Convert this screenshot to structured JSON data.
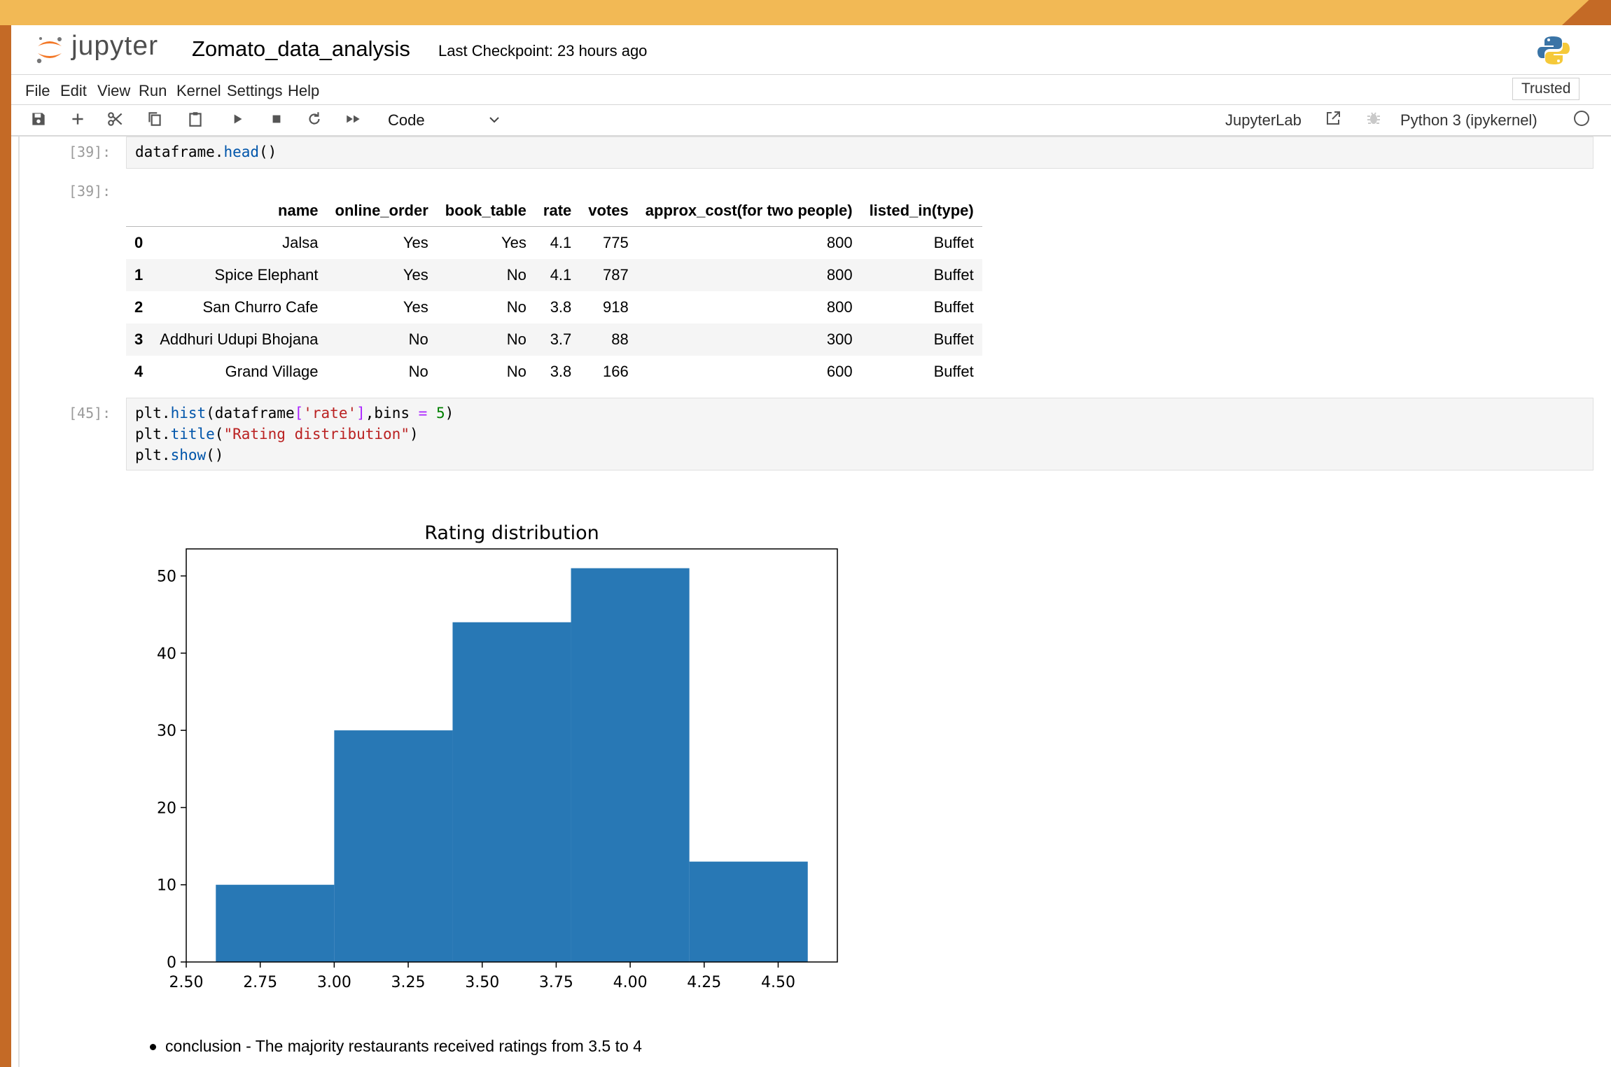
{
  "header": {
    "logo_text": "jupyter",
    "notebook_title": "Zomato_data_analysis",
    "checkpoint": "Last Checkpoint: 23 hours ago"
  },
  "menu": [
    "File",
    "Edit",
    "View",
    "Run",
    "Kernel",
    "Settings",
    "Help"
  ],
  "trusted": "Trusted",
  "toolbar": {
    "cell_type": "Code",
    "jupyterlab_label": "JupyterLab",
    "kernel_label": "Python 3 (ipykernel)",
    "icons": [
      "save-icon",
      "add-cell-icon",
      "cut-icon",
      "copy-icon",
      "paste-icon",
      "run-icon",
      "stop-icon",
      "restart-icon",
      "fast-forward-icon"
    ]
  },
  "cells": [
    {
      "in_prompt": "[39]:",
      "code_lines": [
        "dataframe.head()"
      ],
      "out_prompt": "[39]:"
    },
    {
      "in_prompt": "[45]:",
      "code_lines": [
        "plt.hist(dataframe['rate'],bins = 5)",
        "plt.title(\"Rating distribution\")",
        "plt.show()"
      ]
    }
  ],
  "table": {
    "columns": [
      "name",
      "online_order",
      "book_table",
      "rate",
      "votes",
      "approx_cost(for two people)",
      "listed_in(type)"
    ],
    "rows": [
      {
        "index": "0",
        "cells": [
          "Jalsa",
          "Yes",
          "Yes",
          "4.1",
          "775",
          "800",
          "Buffet"
        ]
      },
      {
        "index": "1",
        "cells": [
          "Spice Elephant",
          "Yes",
          "No",
          "4.1",
          "787",
          "800",
          "Buffet"
        ]
      },
      {
        "index": "2",
        "cells": [
          "San Churro Cafe",
          "Yes",
          "No",
          "3.8",
          "918",
          "800",
          "Buffet"
        ]
      },
      {
        "index": "3",
        "cells": [
          "Addhuri Udupi Bhojana",
          "No",
          "No",
          "3.7",
          "88",
          "300",
          "Buffet"
        ]
      },
      {
        "index": "4",
        "cells": [
          "Grand Village",
          "No",
          "No",
          "3.8",
          "166",
          "600",
          "Buffet"
        ]
      }
    ]
  },
  "chart_data": {
    "type": "bar",
    "title": "Rating distribution",
    "xlabel": "",
    "ylabel": "",
    "bin_edges": [
      2.6,
      3.0,
      3.4,
      3.8,
      4.2,
      4.6
    ],
    "values": [
      10,
      30,
      44,
      51,
      13
    ],
    "xlim": [
      2.5,
      4.7
    ],
    "ylim": [
      0,
      53.5
    ],
    "xticks": [
      2.5,
      2.75,
      3.0,
      3.25,
      3.5,
      3.75,
      4.0,
      4.25,
      4.5
    ],
    "xtick_labels": [
      "2.50",
      "2.75",
      "3.00",
      "3.25",
      "3.50",
      "3.75",
      "4.00",
      "4.25",
      "4.50"
    ],
    "yticks": [
      0,
      10,
      20,
      30,
      40,
      50
    ],
    "ytick_labels": [
      "0",
      "10",
      "20",
      "30",
      "40",
      "50"
    ],
    "bar_color": "#2878b5",
    "grid": false
  },
  "markdown": {
    "conclusion": "conclusion - The majority restaurants received ratings from 3.5 to 4"
  }
}
